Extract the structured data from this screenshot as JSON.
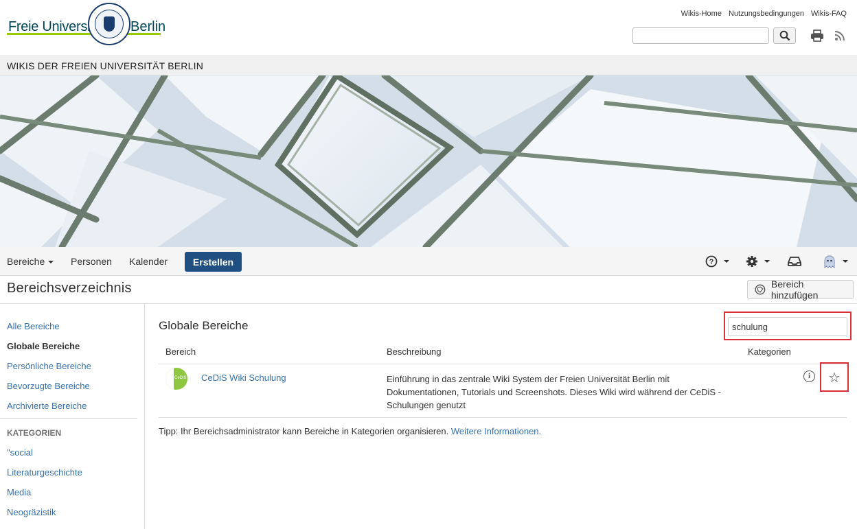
{
  "header": {
    "logo_left": "Freie Universität",
    "logo_right": "Berlin",
    "links": [
      "Wikis-Home",
      "Nutzungsbedingungen",
      "Wikis-FAQ"
    ],
    "search_value": ""
  },
  "wiki_title": "WIKIS DER FREIEN UNIVERSITÄT BERLIN",
  "nav": {
    "spaces": "Bereiche",
    "people": "Personen",
    "calendar": "Kalender",
    "create": "Erstellen"
  },
  "page": {
    "title": "Bereichsverzeichnis",
    "add_space": "Bereich hinzufügen"
  },
  "sidebar": {
    "items": [
      "Alle Bereiche",
      "Globale Bereiche",
      "Persönliche Bereiche",
      "Bevorzugte Bereiche",
      "Archivierte Bereiche"
    ],
    "categories_heading": "KATEGORIEN",
    "categories": [
      "\"social",
      "Literaturgeschichte",
      "Media",
      "Neogräzistik"
    ]
  },
  "main": {
    "title": "Globale Bereiche",
    "filter_value": "schulung",
    "columns": [
      "Bereich",
      "Beschreibung",
      "Kategorien"
    ],
    "rows": [
      {
        "logo_text": "CeDiS",
        "name": "CeDiS Wiki Schulung",
        "description": "Einführung in das zentrale Wiki System der Freien Universität Berlin mit Dokumentationen, Tutorials und Screenshots. Dieses Wiki wird während der CeDiS - Schulungen genutzt",
        "info_glyph": "i",
        "star_glyph": "☆"
      }
    ],
    "tip_text": "Tipp: Ihr Bereichsadministrator kann Bereiche in Kategorien organisieren.",
    "tip_link": "Weitere Informationen."
  },
  "colors": {
    "link": "#3572b0",
    "create_button": "#205081",
    "highlight": "#d9313a",
    "logo_green": "#8ec63f"
  },
  "icons": [
    "search-icon",
    "print-icon",
    "rss-icon",
    "help-icon",
    "gear-icon",
    "inbox-icon",
    "user-avatar-icon",
    "add-space-icon",
    "info-icon",
    "star-icon"
  ]
}
